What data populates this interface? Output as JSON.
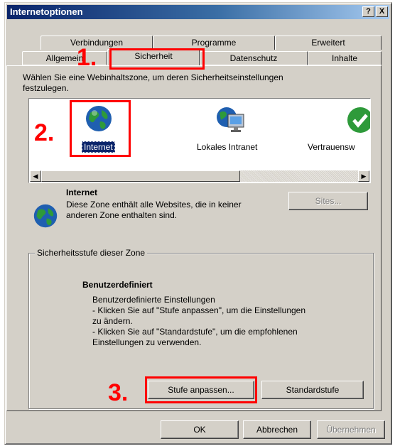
{
  "window": {
    "title": "Internetoptionen",
    "help_button": "?",
    "close_button": "X"
  },
  "tabs_row1": [
    {
      "label": "Verbindungen"
    },
    {
      "label": "Programme"
    },
    {
      "label": "Erweitert"
    }
  ],
  "tabs_row2": [
    {
      "label": "Allgemein"
    },
    {
      "label": "Sicherheit",
      "active": true
    },
    {
      "label": "Datenschutz"
    },
    {
      "label": "Inhalte"
    }
  ],
  "instruction": {
    "line1": "Wählen Sie eine Webinhaltszone, um deren Sicherheitseinstellungen",
    "line2": "festzulegen."
  },
  "zones": [
    {
      "label": "Internet",
      "icon": "globe-icon",
      "selected": true
    },
    {
      "label": "Lokales Intranet",
      "icon": "intranet-icon"
    },
    {
      "label": "Vertrauensw",
      "icon": "trusted-check-icon"
    }
  ],
  "zone_info": {
    "title": "Internet",
    "description_line1": "Diese Zone enthält alle Websites, die in keiner",
    "description_line2": "anderen Zone enthalten sind.",
    "sites_button": "Sites..."
  },
  "security_level": {
    "group_label": "Sicherheitsstufe dieser Zone",
    "level_title": "Benutzerdefiniert",
    "lines": [
      "Benutzerdefinierte Einstellungen",
      "- Klicken Sie auf \"Stufe anpassen\", um die Einstellungen",
      "zu ändern.",
      "- Klicken Sie auf \"Standardstufe\", um die empfohlenen",
      "Einstellungen zu verwenden."
    ],
    "custom_level_button": "Stufe anpassen...",
    "default_level_button": "Standardstufe"
  },
  "footer": {
    "ok_button": "OK",
    "cancel_button": "Abbrechen",
    "apply_button": "Übernehmen"
  },
  "annotations": {
    "step1": "1.",
    "step2": "2.",
    "step3": "3."
  },
  "colors": {
    "highlight_red": "#ff0000",
    "title_blue": "#0a246a",
    "dialog_gray": "#d4d0c8"
  }
}
